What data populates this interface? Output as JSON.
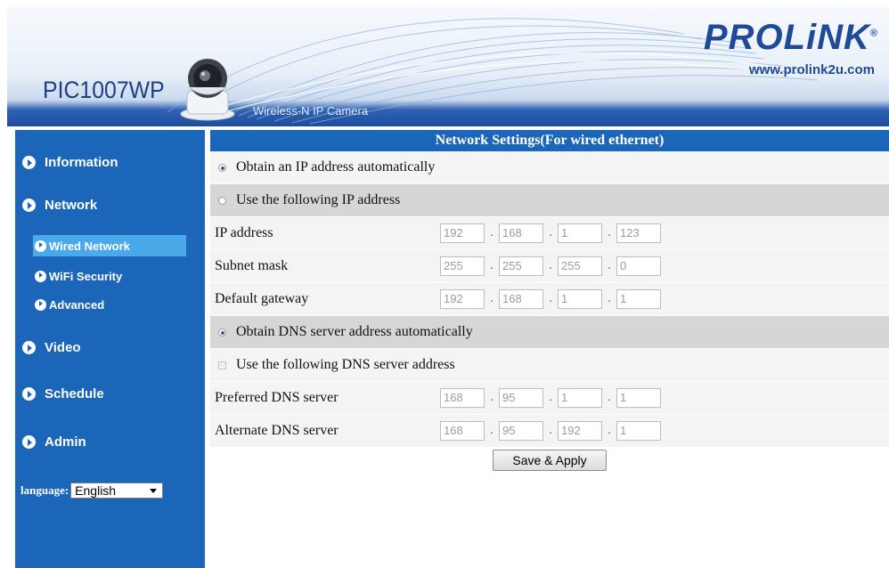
{
  "header": {
    "model": "PIC1007WP",
    "subtitle": "Wireless-N IP Camera",
    "brand": "PROLiNK",
    "brand_mark": "®",
    "url": "www.prolink2u.com"
  },
  "sidebar": {
    "items": [
      {
        "label": "Information"
      },
      {
        "label": "Network"
      },
      {
        "label": "Wired Network",
        "active": true
      },
      {
        "label": "WiFi Security"
      },
      {
        "label": "Advanced"
      },
      {
        "label": "Video"
      },
      {
        "label": "Schedule"
      },
      {
        "label": "Admin"
      }
    ],
    "language_label": "language:",
    "language_value": "English"
  },
  "main": {
    "title": "Network Settings(For wired ethernet)",
    "ip_mode": {
      "auto_label": "Obtain an IP address automatically",
      "manual_label": "Use the following IP address",
      "selected": "auto"
    },
    "ip_fields": [
      {
        "label": "IP address",
        "octets": [
          "192",
          "168",
          "1",
          "123"
        ]
      },
      {
        "label": "Subnet mask",
        "octets": [
          "255",
          "255",
          "255",
          "0"
        ]
      },
      {
        "label": "Default gateway",
        "octets": [
          "192",
          "168",
          "1",
          "1"
        ]
      }
    ],
    "dns_mode": {
      "auto_label": "Obtain DNS server address automatically",
      "manual_label": "Use the following DNS server address",
      "selected": "auto"
    },
    "dns_fields": [
      {
        "label": "Preferred DNS server",
        "octets": [
          "168",
          "95",
          "1",
          "1"
        ]
      },
      {
        "label": "Alternate DNS server",
        "octets": [
          "168",
          "95",
          "192",
          "1"
        ]
      }
    ],
    "save_label": "Save & Apply"
  },
  "colors": {
    "nav_blue": "#1b66b8",
    "nav_active": "#4aa9e9",
    "row_light": "#f4f4f4",
    "row_dark": "#d6d6d6"
  }
}
